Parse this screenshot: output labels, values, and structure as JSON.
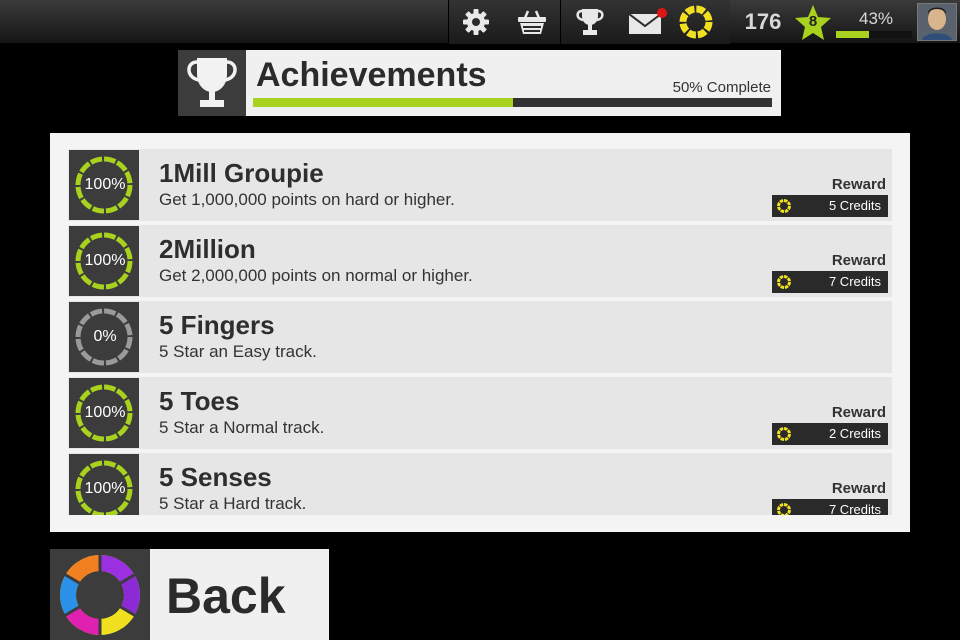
{
  "topbar": {
    "icons": [
      "gear-icon",
      "shop-basket-icon",
      "trophy-icon",
      "mail-icon",
      "credits-coin-icon"
    ],
    "mail_notification": true,
    "coins": "176",
    "level": "8",
    "xp_percent_label": "43%",
    "xp_progress": 0.43
  },
  "header": {
    "title": "Achievements",
    "complete_label": "50% Complete",
    "progress": 0.5
  },
  "colors": {
    "accent_green": "#a8d21e",
    "coin_yellow": "#f0e020",
    "incomplete_gray": "#9a9a9a"
  },
  "achievements": [
    {
      "percent": "100%",
      "title": "1Mill Groupie",
      "desc": "Get 1,000,000 points on hard or higher.",
      "reward_label": "Reward",
      "credits": "5 Credits",
      "complete": true
    },
    {
      "percent": "100%",
      "title": "2Million",
      "desc": "Get 2,000,000 points on normal or higher.",
      "reward_label": "Reward",
      "credits": "7 Credits",
      "complete": true
    },
    {
      "percent": "0%",
      "title": "5 Fingers",
      "desc": "5 Star an Easy track.",
      "reward_label": "",
      "credits": "",
      "complete": false
    },
    {
      "percent": "100%",
      "title": "5 Toes",
      "desc": "5 Star a Normal track.",
      "reward_label": "Reward",
      "credits": "2 Credits",
      "complete": true
    },
    {
      "percent": "100%",
      "title": "5 Senses",
      "desc": "5 Star a Hard track.",
      "reward_label": "Reward",
      "credits": "7 Credits",
      "complete": true
    }
  ],
  "back": {
    "label": "Back"
  }
}
